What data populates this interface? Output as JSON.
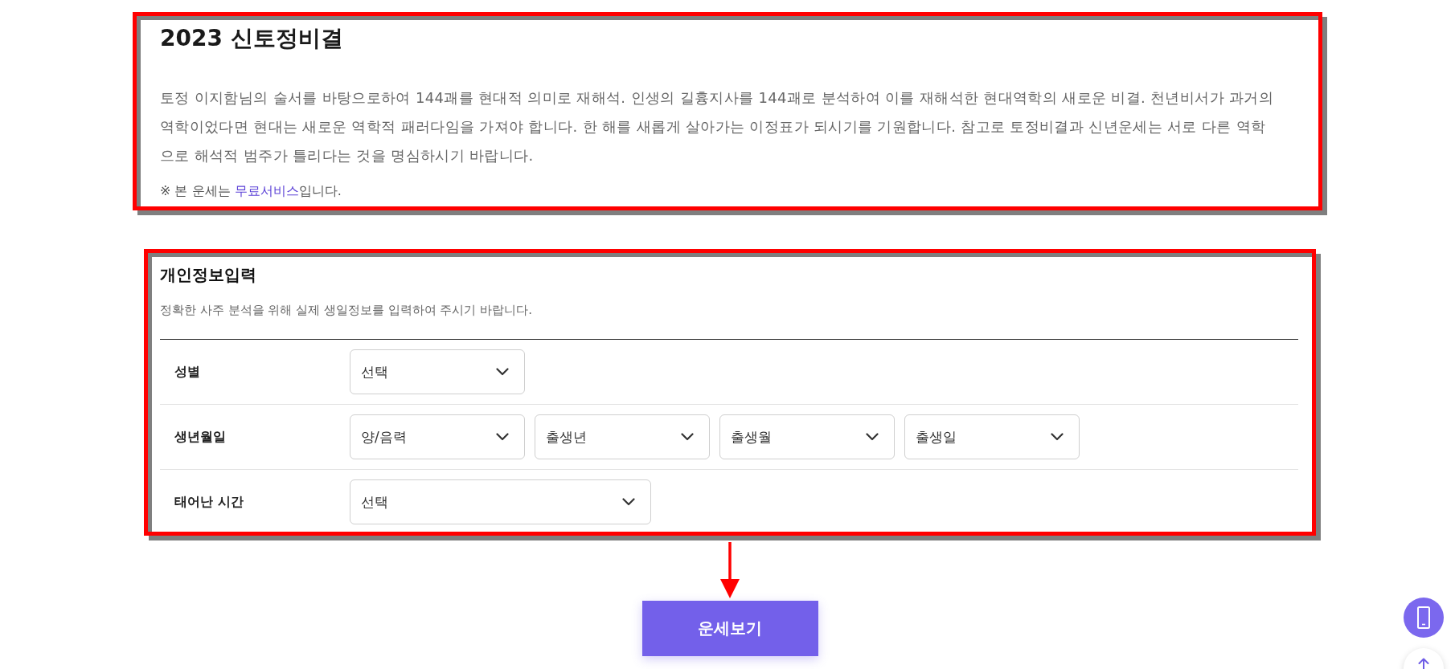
{
  "intro": {
    "title": "2023 신토정비결",
    "description": "토정 이지함님의 술서를 바탕으로하여 144괘를 현대적 의미로 재해석. 인생의 길흉지사를 144괘로 분석하여 이를 재해석한 현대역학의 새로운 비결. 천년비서가 과거의 역학이었다면 현대는 새로운 역학적 패러다임을 가져야 합니다. 한 해를 새롭게 살아가는 이정표가 되시기를 기원합니다. 참고로 토정비결과 신년운세는 서로 다른 역학으로 해석적 범주가 틀리다는 것을 명심하시기 바랍니다.",
    "notice": {
      "prefix": "※ 본 운세는 ",
      "link": "무료서비스",
      "suffix": "입니다."
    }
  },
  "form": {
    "title": "개인정보입력",
    "subtitle": "정확한 사주 분석을 위해 실제 생일정보를 입력하여 주시기 바랍니다.",
    "rows": [
      {
        "label": "성별",
        "selects": [
          {
            "value": "선택"
          }
        ]
      },
      {
        "label": "생년월일",
        "selects": [
          {
            "value": "양/음력"
          },
          {
            "value": "출생년"
          },
          {
            "value": "출생월"
          },
          {
            "value": "출생일"
          }
        ]
      },
      {
        "label": "태어난 시간",
        "selects": [
          {
            "value": "선택"
          }
        ]
      }
    ]
  },
  "submit_button": {
    "label": "운세보기"
  }
}
